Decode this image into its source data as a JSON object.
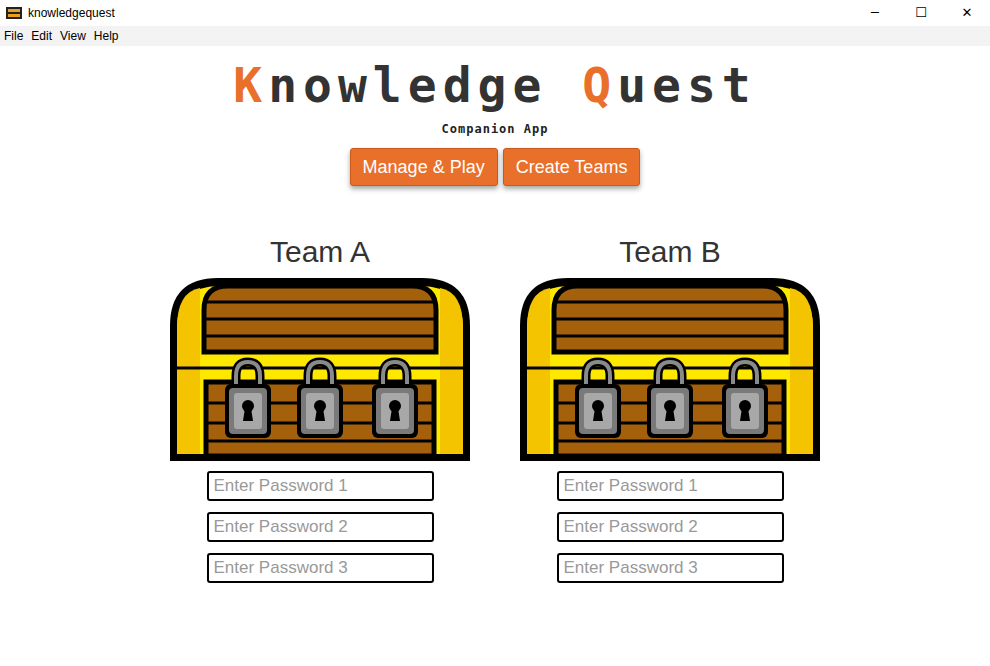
{
  "window": {
    "title": "knowledgequest",
    "controls": [
      "─",
      "☐",
      "✕"
    ]
  },
  "menu": [
    "File",
    "Edit",
    "View",
    "Help"
  ],
  "logo": {
    "parts": [
      {
        "text": "K",
        "accent": true
      },
      {
        "text": "nowledge ",
        "accent": false
      },
      {
        "text": "Q",
        "accent": true
      },
      {
        "text": "uest",
        "accent": false
      }
    ],
    "subtitle": "Companion App"
  },
  "nav_buttons": [
    "Manage & Play",
    "Create Teams"
  ],
  "teams": [
    {
      "name": "Team A",
      "locks": [
        {
          "locked": true
        },
        {
          "locked": true
        },
        {
          "locked": true
        }
      ],
      "passwords": [
        {
          "placeholder": "Enter Password 1"
        },
        {
          "placeholder": "Enter Password 2"
        },
        {
          "placeholder": "Enter Password 3"
        }
      ]
    },
    {
      "name": "Team B",
      "locks": [
        {
          "locked": true
        },
        {
          "locked": true
        },
        {
          "locked": true
        }
      ],
      "passwords": [
        {
          "placeholder": "Enter Password 1"
        },
        {
          "placeholder": "Enter Password 2"
        },
        {
          "placeholder": "Enter Password 3"
        }
      ]
    }
  ]
}
